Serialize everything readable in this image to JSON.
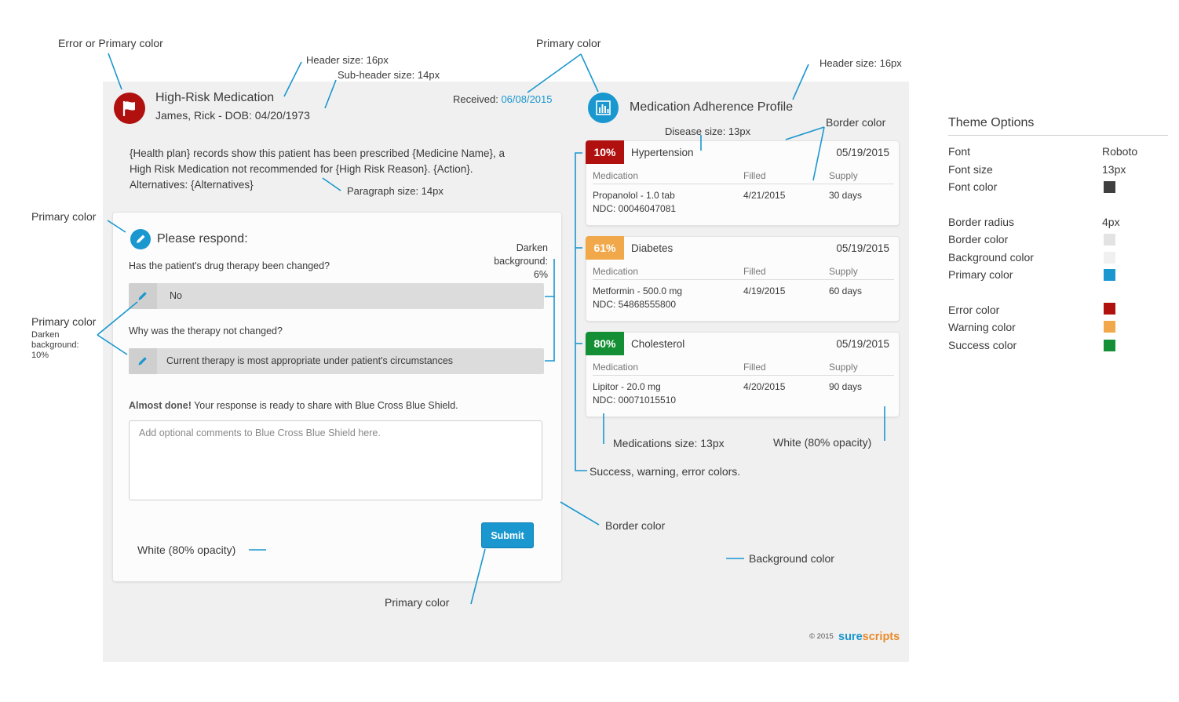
{
  "colors": {
    "primary": "#1a97cf",
    "error": "#b0100e",
    "warning": "#f0a84b",
    "success": "#148f35",
    "font": "#3f3f3f",
    "border": "#e3e3e3",
    "background": "#f0f0f0"
  },
  "annotations": {
    "error_or_primary": "Error or Primary color",
    "header_size_left": "Header size: 16px",
    "subheader_size": "Sub-header size: 14px",
    "primary_top": "Primary color",
    "header_size_right": "Header size: 16px",
    "disease_size": "Disease size: 13px",
    "border_color_top": "Border color",
    "paragraph_size": "Paragraph size: 14px",
    "primary_left": "Primary color",
    "darken_6": "Darken background: 6%",
    "primary_left2": "Primary color",
    "darken_10": "Darken background: 10%",
    "medications_size": "Medications size: 13px",
    "white_80_right": "White (80% opacity)",
    "status_colors": "Success, warning, error colors.",
    "border_color_mid": "Border color",
    "white_80_left": "White (80% opacity)",
    "background_color": "Background color",
    "primary_bottom": "Primary color"
  },
  "header": {
    "icon": "flag-icon",
    "title": "High-Risk Medication",
    "subtitle": "James, Rick - DOB: 04/20/1973",
    "received_label": "Received:",
    "received_date": "06/08/2015"
  },
  "paragraph": {
    "line1": "{Health plan} records show this patient has been prescribed {Medicine Name}, a",
    "line2": "High Risk Medication not recommended for {High Risk Reason}. {Action}.",
    "line3": "Alternatives: {Alternatives}"
  },
  "respond": {
    "icon": "pencil-icon",
    "title": "Please respond:",
    "question1": "Has the patient's drug therapy been changed?",
    "answer1": "No",
    "question2": "Why was the therapy not changed?",
    "answer2": "Current therapy is most appropriate under patient's circumstances",
    "almost_bold": "Almost done!",
    "almost_text": " Your response is ready to share with Blue Cross Blue Shield.",
    "comment_placeholder": "Add optional comments to Blue Cross Blue Shield here.",
    "submit_label": "Submit"
  },
  "adherence": {
    "icon": "bar-chart-icon",
    "title": "Medication Adherence Profile",
    "col_medication": "Medication",
    "col_filled": "Filled",
    "col_supply": "Supply",
    "cards": [
      {
        "percent": "10%",
        "status": "error",
        "disease": "Hypertension",
        "date": "05/19/2015",
        "medication": "Propanolol - 1.0 tab",
        "ndc": "NDC: 00046047081",
        "filled": "4/21/2015",
        "supply": "30 days"
      },
      {
        "percent": "61%",
        "status": "warning",
        "disease": "Diabetes",
        "date": "05/19/2015",
        "medication": "Metformin - 500.0 mg",
        "ndc": "NDC: 54868555800",
        "filled": "4/19/2015",
        "supply": "60 days"
      },
      {
        "percent": "80%",
        "status": "success",
        "disease": "Cholesterol",
        "date": "05/19/2015",
        "medication": "Lipitor - 20.0 mg",
        "ndc": "NDC: 00071015510",
        "filled": "4/20/2015",
        "supply": "90 days"
      }
    ]
  },
  "footer": {
    "copyright": "© 2015",
    "brand_sure": "sure",
    "brand_scripts": "scripts"
  },
  "theme": {
    "title": "Theme Options",
    "font_label": "Font",
    "font_value": "Roboto",
    "font_size_label": "Font size",
    "font_size_value": "13px",
    "font_color_label": "Font color",
    "border_radius_label": "Border radius",
    "border_radius_value": "4px",
    "border_color_label": "Border color",
    "background_color_label": "Background color",
    "primary_color_label": "Primary color",
    "error_color_label": "Error color",
    "warning_color_label": "Warning color",
    "success_color_label": "Success color"
  }
}
